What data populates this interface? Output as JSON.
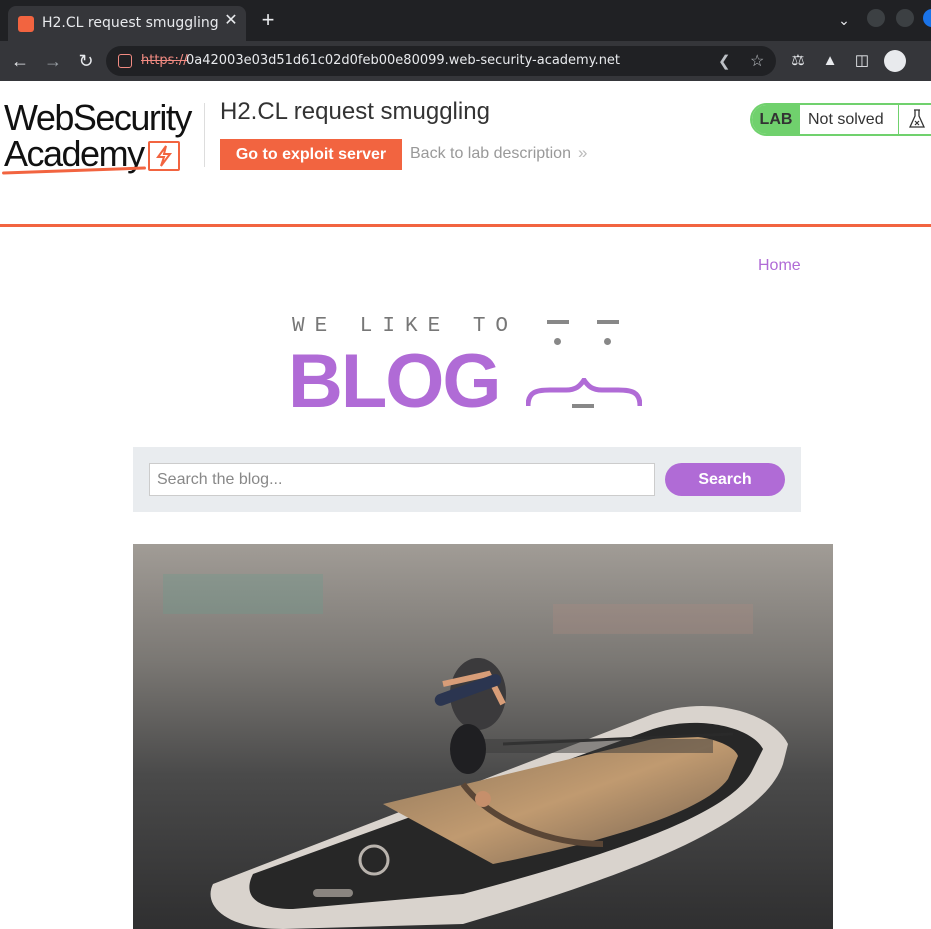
{
  "browser": {
    "tab_title": "H2.CL request smuggling",
    "tab_close": "✕",
    "new_tab": "+",
    "url_scheme": "https://",
    "url_rest": "0a42003e03d51d61c02d0feb00e80099.web-security-academy.net"
  },
  "academy": {
    "logo_line1": "WebSecurity",
    "logo_line2": "Academy",
    "lab_title": "H2.CL request smuggling",
    "exploit_button": "Go to exploit server",
    "back_link": "Back to lab description",
    "back_chevron": "»",
    "lab_label": "LAB",
    "lab_status": "Not solved"
  },
  "blog": {
    "home_link": "Home",
    "tagline": "WE LIKE TO",
    "title_word": "BLOG",
    "search_placeholder": "Search the blog...",
    "search_button": "Search"
  },
  "icons": {
    "back": "arrow-left-icon",
    "forward": "arrow-right-icon",
    "reload": "reload-icon",
    "not_secure": "not-secure-icon",
    "share": "share-icon",
    "star": "star-icon",
    "extensions": "puzzle-icon",
    "labs": "flask-icon",
    "sidebar": "sidebar-icon",
    "profile": "profile-icon"
  },
  "colors": {
    "accent_orange": "#f26440",
    "blog_purple": "#b06bd6",
    "lab_green": "#70d16d"
  }
}
